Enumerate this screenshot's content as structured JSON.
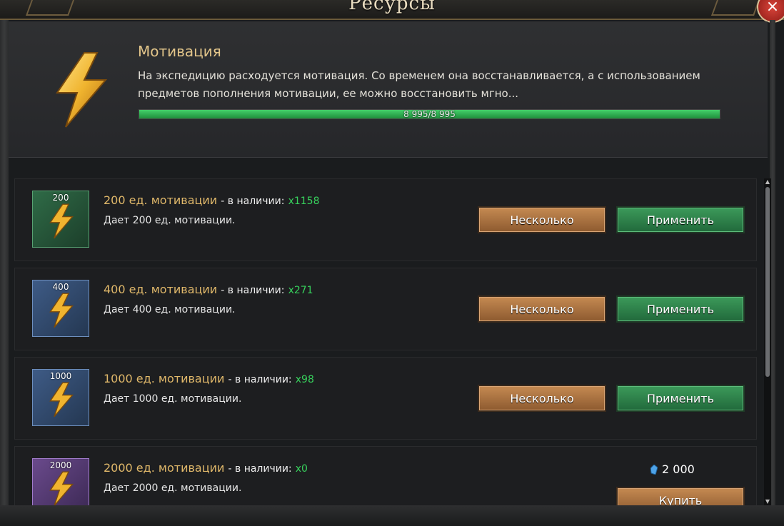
{
  "window": {
    "title": "Ресурсы",
    "close_icon": "×"
  },
  "resource": {
    "name": "Мотивация",
    "description": "На экспедицию расходуется мотивация. Со временем она восстанавливается, а с использованием предметов пополнения мотивации, ее можно восстановить мгно...",
    "progress_text": "8 995/8 995",
    "progress_fraction": 1.0,
    "icon": "lightning-bolt-icon"
  },
  "labels": {
    "available": "- в наличии:",
    "multiple_button": "Несколько",
    "apply_button": "Применить",
    "buy_button": "Купить"
  },
  "items": [
    {
      "qty": "200",
      "title": "200 ед. мотивации",
      "count": "x1158",
      "desc": "Дает 200 ед. мотивации.",
      "rarity": "green"
    },
    {
      "qty": "400",
      "title": "400 ед. мотивации",
      "count": "x271",
      "desc": "Дает 400 ед. мотивации.",
      "rarity": "blue"
    },
    {
      "qty": "1000",
      "title": "1000 ед. мотивации",
      "count": "x98",
      "desc": "Дает 1000 ед. мотивации.",
      "rarity": "blue"
    },
    {
      "qty": "2000",
      "title": "2000 ед. мотивации",
      "count": "x0",
      "desc": "Дает 2000 ед. мотивации.",
      "rarity": "purple",
      "price": "2 000"
    }
  ],
  "colors": {
    "accent_gold": "#e0b86a",
    "count_green": "#37d15c",
    "progress_green": "#44d06a"
  }
}
